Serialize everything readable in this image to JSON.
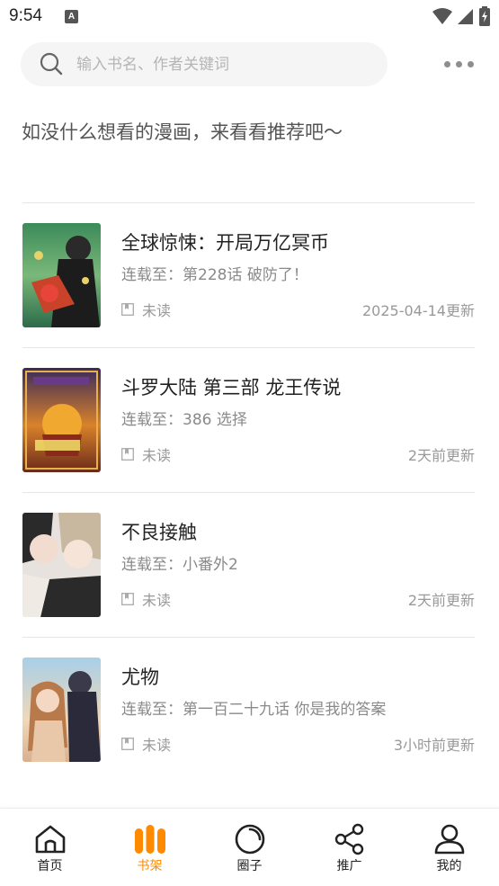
{
  "status_bar": {
    "time": "9:54",
    "notification_letter": "A"
  },
  "search": {
    "placeholder": "输入书名、作者关键词"
  },
  "recommend_text": "如没什么想看的漫画，来看看推荐吧～",
  "books": [
    {
      "title": "全球惊悚：开局万亿冥币",
      "latest": "连载至：第228话 破防了！",
      "read_status": "未读",
      "updated": "2025-04-14更新"
    },
    {
      "title": "斗罗大陆 第三部 龙王传说",
      "latest": "连载至：386 选择",
      "read_status": "未读",
      "updated": "2天前更新"
    },
    {
      "title": "不良接触",
      "latest": "连载至：小番外2",
      "read_status": "未读",
      "updated": "2天前更新"
    },
    {
      "title": "尤物",
      "latest": "连载至：第一百二十九话 你是我的答案",
      "read_status": "未读",
      "updated": "3小时前更新"
    }
  ],
  "tabs": [
    {
      "label": "首页",
      "icon": "home-icon",
      "active": false
    },
    {
      "label": "书架",
      "icon": "bookshelf-icon",
      "active": true
    },
    {
      "label": "圈子",
      "icon": "circle-icon",
      "active": false
    },
    {
      "label": "推广",
      "icon": "share-icon",
      "active": false
    },
    {
      "label": "我的",
      "icon": "profile-icon",
      "active": false
    }
  ],
  "colors": {
    "accent": "#ff8a00",
    "text_primary": "#222222",
    "text_secondary": "#8a8a8a",
    "divider": "#e6e6e6",
    "search_bg": "#f5f5f5"
  }
}
